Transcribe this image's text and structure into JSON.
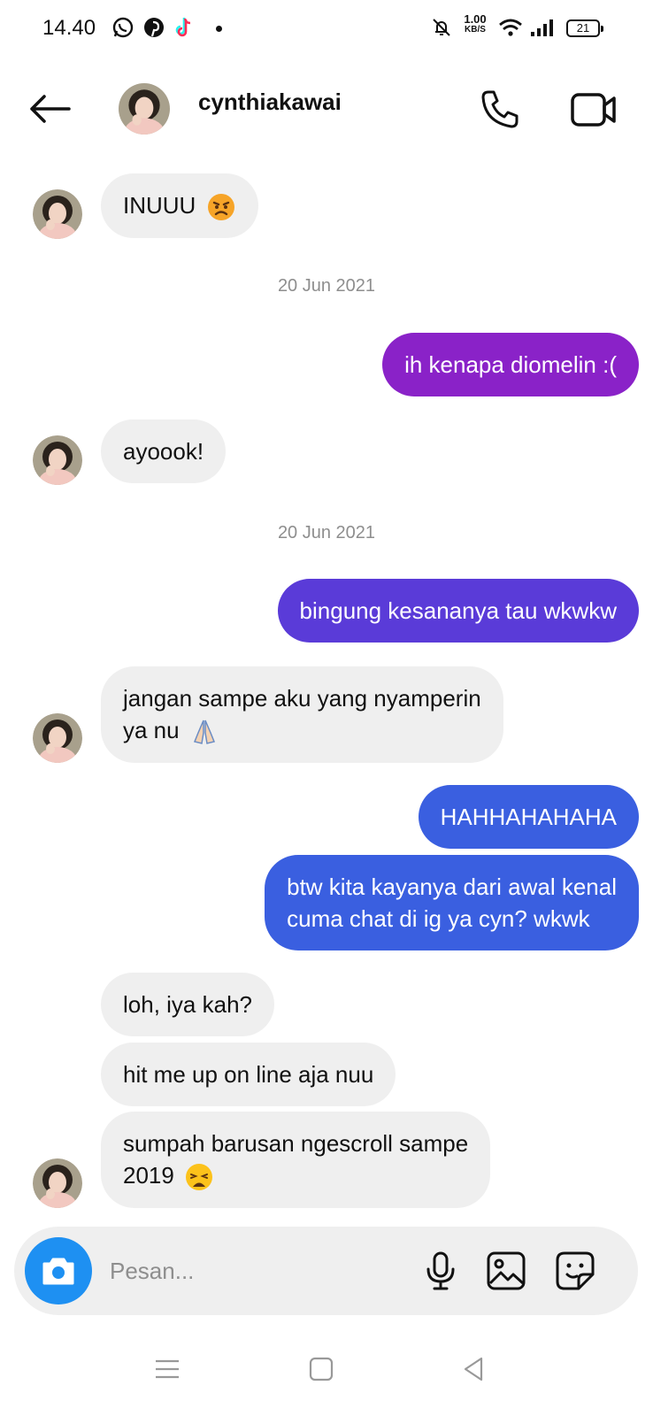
{
  "status_bar": {
    "time": "14.40",
    "net_speed_value": "1.00",
    "net_speed_unit": "KB/S",
    "battery": "21"
  },
  "header": {
    "username": "cynthiakawai"
  },
  "messages": [
    {
      "text": "INUUU",
      "emoji": "angry-face-emoji"
    },
    {
      "date": "20 Jun 2021"
    },
    {
      "text": "ih kenapa diomelin :("
    },
    {
      "text": "ayoook!"
    },
    {
      "date": "20 Jun 2021"
    },
    {
      "text": "bingung kesananya tau wkwkw"
    },
    {
      "text": "jangan sampe aku yang nyamperin",
      "text2": "ya nu",
      "emoji": "folded-hands-emoji"
    },
    {
      "text": "HAHHAHAHAHA"
    },
    {
      "text": "btw kita kayanya dari awal kenal",
      "text2": "cuma chat di ig ya cyn? wkwk"
    },
    {
      "text": "loh, iya kah?"
    },
    {
      "text": "hit me up on line aja nuu"
    },
    {
      "text": "sumpah barusan ngescroll sampe",
      "text2": "2019",
      "emoji": "weary-face-emoji"
    }
  ],
  "composer": {
    "placeholder": "Pesan..."
  },
  "colors": {
    "received_bubble": "#efefef",
    "sent_purple": "#8a22c8",
    "sent_violet": "#5a3bd8",
    "sent_blue": "#3a5fe0",
    "camera_button": "#1e90f2",
    "date_text": "#8e8e8e"
  },
  "icons": [
    "whatsapp-icon",
    "pinterest-icon",
    "tiktok-icon",
    "mute-icon",
    "wifi-icon",
    "signal-icon",
    "battery-icon",
    "back-arrow-icon",
    "phone-icon",
    "video-camera-icon",
    "camera-icon",
    "microphone-icon",
    "gallery-icon",
    "sticker-icon",
    "menu-icon",
    "home-icon",
    "back-icon"
  ]
}
